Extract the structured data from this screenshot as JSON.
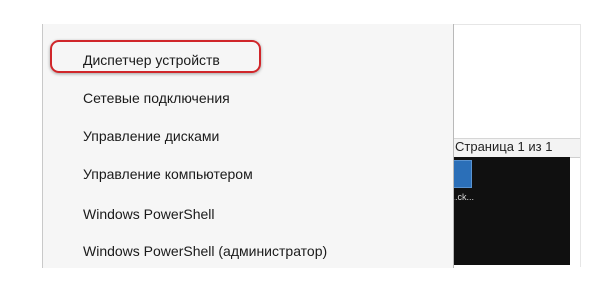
{
  "background_window": {
    "page_indicator": "Страница 1 из 1",
    "tile_caption": "...ck...",
    "tile_caption2": "..."
  },
  "context_menu": {
    "items": [
      {
        "label": "Диспетчер устройств",
        "highlighted": true
      },
      {
        "label": "Сетевые подключения"
      },
      {
        "label": "Управление дисками"
      },
      {
        "label": "Управление компьютером"
      },
      {
        "label": "Windows PowerShell"
      },
      {
        "label": "Windows PowerShell (администратор)"
      }
    ]
  },
  "colors": {
    "highlight_border": "#d0262a",
    "menu_background": "#f6f6f6",
    "desktop_dark": "#101010",
    "tile_blue": "#2b6fb8"
  }
}
